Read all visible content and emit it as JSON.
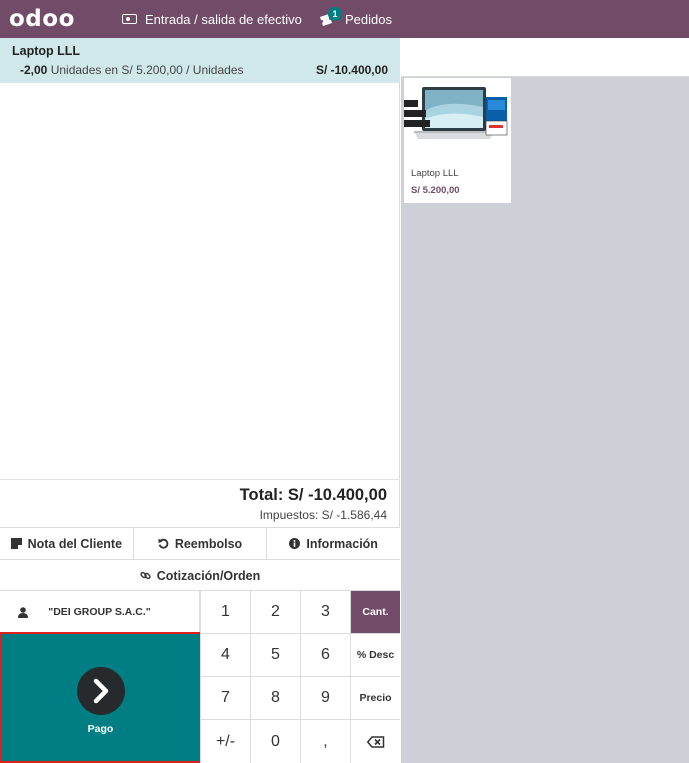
{
  "topbar": {
    "logo": "odoo",
    "cash_label": "Entrada / salida de efectivo",
    "orders_label": "Pedidos",
    "orders_badge": "1"
  },
  "order": {
    "lines": [
      {
        "name": "Laptop LLL",
        "qty": "-2,00",
        "detail": "Unidades en S/ 5.200,00 / Unidades",
        "price": "S/ -10.400,00"
      }
    ],
    "total": "Total: S/ -10.400,00",
    "taxes": "Impuestos: S/ -1.586,44"
  },
  "controls": {
    "customer_note": "Nota del Cliente",
    "refund": "Reembolso",
    "info": "Información",
    "quotation": "Cotización/Orden"
  },
  "customer": {
    "name": "\"DEI GROUP S.A.C.\""
  },
  "pay": {
    "label": "Pago"
  },
  "numpad": {
    "keys": [
      "1",
      "2",
      "3",
      "Cant.",
      "4",
      "5",
      "6",
      "% Desc",
      "7",
      "8",
      "9",
      "Precio",
      "+/-",
      "0",
      ",",
      ""
    ],
    "active_mode": "Cant."
  },
  "products": [
    {
      "name": "Laptop LLL",
      "price": "S/ 5.200,00"
    }
  ],
  "colors": {
    "brand": "#714b67",
    "pay": "#017e84",
    "selected_line": "#d1e8ea",
    "highlight_border": "#e0201c"
  }
}
